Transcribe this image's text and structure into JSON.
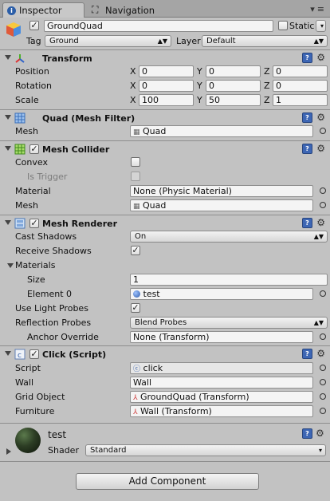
{
  "tabs": {
    "inspector": "Inspector",
    "navigation": "Navigation"
  },
  "object": {
    "name": "GroundQuad",
    "static_label": "Static",
    "tag_label": "Tag",
    "tag_value": "Ground",
    "layer_label": "Layer",
    "layer_value": "Default"
  },
  "transform": {
    "title": "Transform",
    "position_label": "Position",
    "rotation_label": "Rotation",
    "scale_label": "Scale",
    "x": "X",
    "y": "Y",
    "z": "Z",
    "pos": {
      "x": "0",
      "y": "0",
      "z": "0"
    },
    "rot": {
      "x": "0",
      "y": "0",
      "z": "0"
    },
    "scale": {
      "x": "100",
      "y": "50",
      "z": "1"
    }
  },
  "mesh_filter": {
    "title": "Quad (Mesh Filter)",
    "mesh_label": "Mesh",
    "mesh_value": "Quad"
  },
  "mesh_collider": {
    "title": "Mesh Collider",
    "convex_label": "Convex",
    "trigger_label": "Is Trigger",
    "material_label": "Material",
    "material_value": "None (Physic Material)",
    "mesh_label": "Mesh",
    "mesh_value": "Quad"
  },
  "mesh_renderer": {
    "title": "Mesh Renderer",
    "cast_label": "Cast Shadows",
    "cast_value": "On",
    "receive_label": "Receive Shadows",
    "materials_label": "Materials",
    "size_label": "Size",
    "size_value": "1",
    "element_label": "Element 0",
    "element_value": "test",
    "light_label": "Use Light Probes",
    "refl_label": "Reflection Probes",
    "refl_value": "Blend Probes",
    "anchor_label": "Anchor Override",
    "anchor_value": "None (Transform)"
  },
  "click_script": {
    "title": "Click (Script)",
    "script_label": "Script",
    "script_value": "click",
    "wall_label": "Wall",
    "wall_value": "Wall",
    "grid_label": "Grid Object",
    "grid_value": "GroundQuad (Transform)",
    "furn_label": "Furniture",
    "furn_value": "Wall (Transform)"
  },
  "material": {
    "name": "test",
    "shader_label": "Shader",
    "shader_value": "Standard"
  },
  "add_component": "Add Component",
  "icons": {
    "check": "✓",
    "gear": "⚙"
  }
}
